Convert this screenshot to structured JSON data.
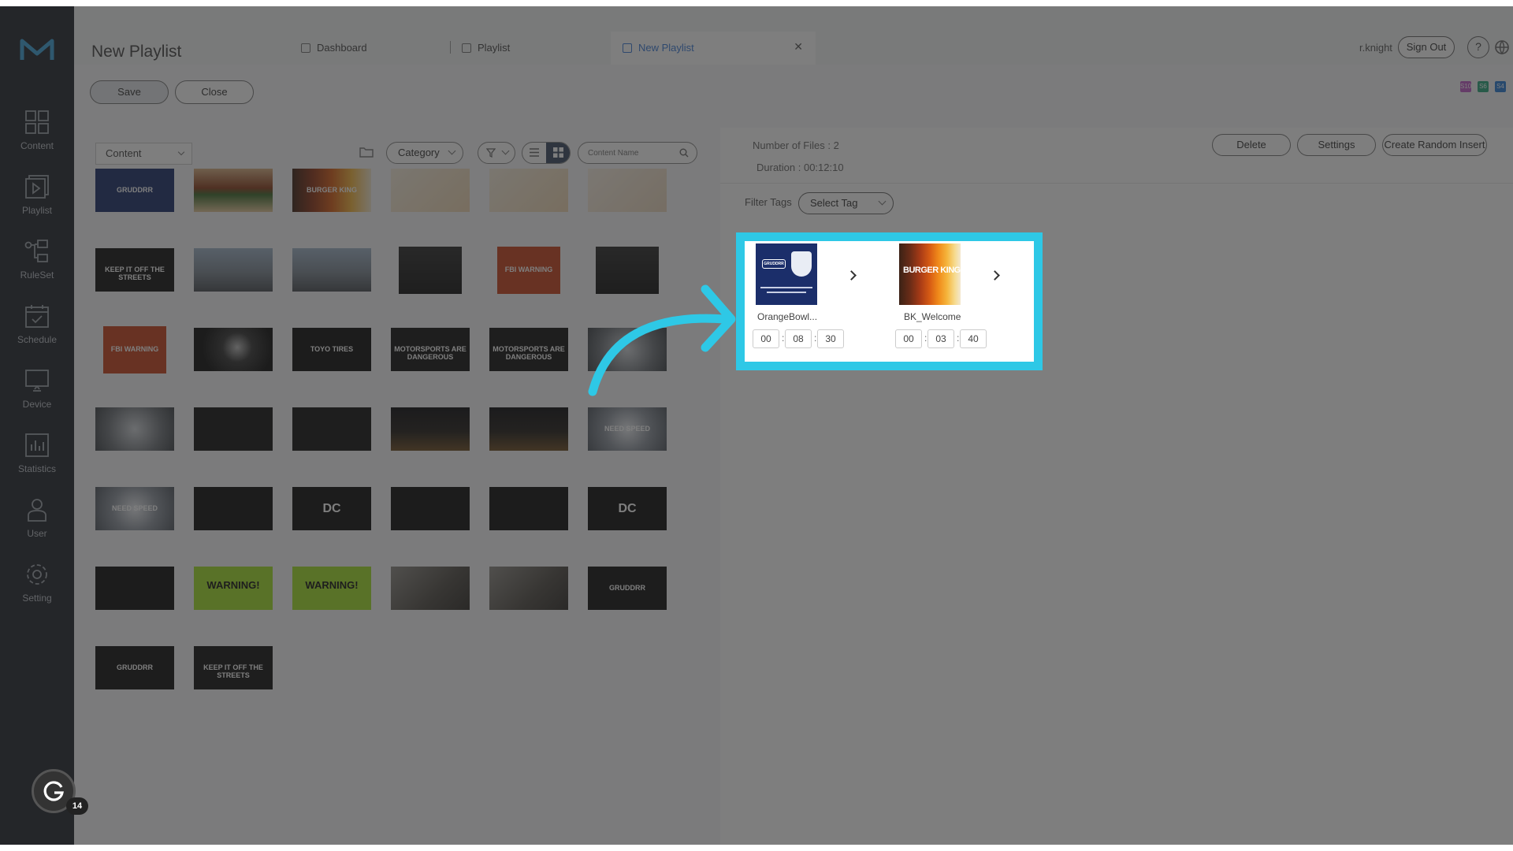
{
  "nav": {
    "items": [
      {
        "label": "Content"
      },
      {
        "label": "Playlist"
      },
      {
        "label": "RuleSet"
      },
      {
        "label": "Schedule"
      },
      {
        "label": "Device"
      },
      {
        "label": "Statistics"
      },
      {
        "label": "User"
      },
      {
        "label": "Setting"
      }
    ]
  },
  "header": {
    "title": "New Playlist",
    "tabs": [
      {
        "label": "Dashboard"
      },
      {
        "label": "Playlist"
      },
      {
        "label": "New Playlist"
      }
    ],
    "user": "r.knight",
    "sign_out": "Sign Out",
    "help": "?"
  },
  "toolbar": {
    "save": "Save",
    "close": "Close",
    "chips": [
      {
        "text": "S10",
        "color": "#c05bc8"
      },
      {
        "text": "S6",
        "color": "#2aa67a"
      },
      {
        "text": "S4",
        "color": "#2a7bd5"
      }
    ]
  },
  "content_panel": {
    "content_select": "Content",
    "category_select": "Category",
    "search_placeholder": "Content Name",
    "thumbnails": [
      {
        "theme": "gruden",
        "text": "GRUDDRR"
      },
      {
        "theme": "burger",
        "text": ""
      },
      {
        "theme": "bk",
        "text": "BURGER KING"
      },
      {
        "theme": "menu",
        "text": ""
      },
      {
        "theme": "menu",
        "text": ""
      },
      {
        "theme": "menu2",
        "text": ""
      },
      {
        "theme": "warn-dark",
        "text": "KEEP IT OFF THE STREETS"
      },
      {
        "theme": "road",
        "text": ""
      },
      {
        "theme": "road",
        "text": ""
      },
      {
        "theme": "dark",
        "text": ""
      },
      {
        "theme": "fbi",
        "text": "FBI WARNING"
      },
      {
        "theme": "dark",
        "text": ""
      },
      {
        "theme": "fbi",
        "text": "FBI WARNING"
      },
      {
        "theme": "tunnel",
        "text": ""
      },
      {
        "theme": "black",
        "text": "TOYO TIRES"
      },
      {
        "theme": "warn-dark",
        "text": "MOTORSPORTS ARE DANGEROUS"
      },
      {
        "theme": "warn-dark",
        "text": "MOTORSPORTS ARE DANGEROUS"
      },
      {
        "theme": "smoke",
        "text": ""
      },
      {
        "theme": "smoke",
        "text": ""
      },
      {
        "theme": "warn-dark",
        "text": ""
      },
      {
        "theme": "warn-dark",
        "text": ""
      },
      {
        "theme": "city",
        "text": ""
      },
      {
        "theme": "city",
        "text": ""
      },
      {
        "theme": "nfs",
        "text": "NEED SPEED"
      },
      {
        "theme": "nfs",
        "text": "NEED SPEED"
      },
      {
        "theme": "black",
        "text": ""
      },
      {
        "theme": "black",
        "text": "DC"
      },
      {
        "theme": "black",
        "text": ""
      },
      {
        "theme": "black",
        "text": ""
      },
      {
        "theme": "black",
        "text": "DC"
      },
      {
        "theme": "black",
        "text": ""
      },
      {
        "theme": "lime",
        "text": "WARNING!"
      },
      {
        "theme": "lime",
        "text": "WARNING!"
      },
      {
        "theme": "room",
        "text": ""
      },
      {
        "theme": "room",
        "text": ""
      },
      {
        "theme": "gruden-dark",
        "text": "GRUDDRR"
      },
      {
        "theme": "gruden-dark",
        "text": "GRUDDRR"
      },
      {
        "theme": "warn-dark",
        "text": "KEEP IT OFF THE STREETS"
      }
    ]
  },
  "playlist_panel": {
    "number_of_files": "Number of Files : 2",
    "duration": "Duration : 00:12:10",
    "delete": "Delete",
    "settings": "Settings",
    "random_insert": "Create Random Insert",
    "filter_tags_label": "Filter Tags",
    "select_tag": "Select Tag",
    "items": [
      {
        "name": "OrangeBowl...",
        "hh": "00",
        "mm": "08",
        "ss": "30"
      },
      {
        "name": "BK_Welcome",
        "hh": "00",
        "mm": "03",
        "ss": "40"
      }
    ]
  },
  "badge": {
    "count": "14"
  }
}
